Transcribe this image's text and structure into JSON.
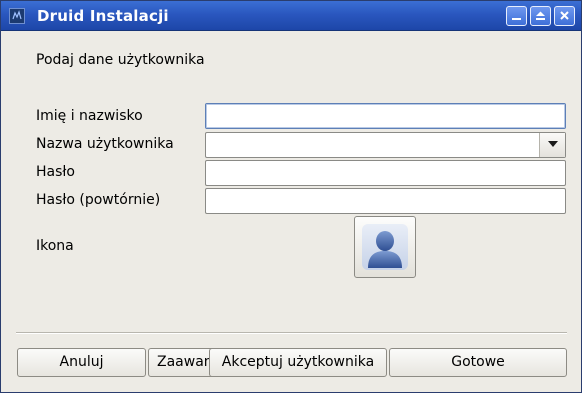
{
  "window": {
    "title": "Druid Instalacji"
  },
  "header": {
    "text": "Podaj dane użytkownika"
  },
  "form": {
    "fullname": {
      "label": "Imię i nazwisko",
      "value": ""
    },
    "username": {
      "label": "Nazwa użytkownika",
      "value": ""
    },
    "password": {
      "label": "Hasło",
      "value": ""
    },
    "password_repeat": {
      "label": "Hasło (powtórnie)",
      "value": ""
    },
    "icon": {
      "label": "Ikona",
      "icon_name": "user-avatar-icon"
    }
  },
  "buttons": {
    "cancel": "Anuluj",
    "advanced": "Zaawansowane",
    "accept_user": "Akceptuj użytkownika",
    "done": "Gotowe"
  },
  "colors": {
    "titlebar": "#2a57bf",
    "background": "#edebe5",
    "focus_border": "#5d7fb6"
  }
}
